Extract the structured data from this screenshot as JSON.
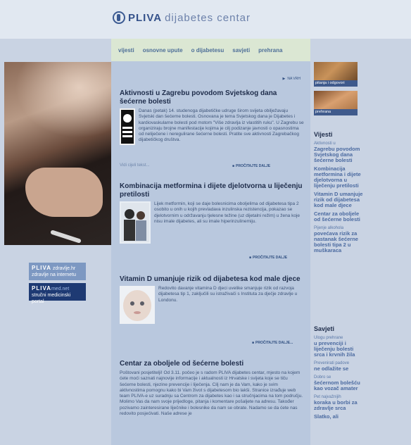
{
  "header": {
    "brand": "PLIVA",
    "subtitle": "dijabetes centar"
  },
  "nav": {
    "items": [
      "vijesti",
      "osnovne upute",
      "o dijabetesu",
      "savjeti",
      "prehrana"
    ]
  },
  "main": {
    "top_control": "NA VRH",
    "articles": [
      {
        "title": "Aktivnosti u Zagrebu povodom Svjetskog dana šećerne bolesti",
        "body": "Danas (petak) 14. studenoga dijabetičke udruge širom svijeta obilježavaju Svjetski dan šećerne bolesti. Osnovana je tema Svjetskog dana je Dijabetes i kardiovaskularne bolesti pod motom \"Više zdravlja iz vlastitih ruku\". U Zagrebu se organiziraju brojne manifestacije kojima je cilj podizanje javnosti o opasnostima od neliječene i neregulirane šećerne bolesti. Pratite sve aktivnosti Zagrebačkog dijabetičkog društva.",
        "lead": "Vidi cijeli tekst...",
        "more": "PROČITAJTE DALJE"
      },
      {
        "title": "Kombinacija metformina i dijete djelotvorna u liječenju pretilosti",
        "body": "Lijek metformin, koji se daje bolesnicima oboljelima od dijabetesa tipa 2 osobito u onih u kojih prevladava inzulinska rezistencija, pokazao se djelotvornim u održavanju tjelesne težine (uz dijetalni režim) u žena koje nisu imale dijabetes, ali su imale hiperinzulinemiju.",
        "more": "PROČITAJTE DALJE"
      },
      {
        "title": "Vitamin D umanjuje rizik od dijabetesa kod male djece",
        "body": "Redovito davanje vitamina D djeci uvelike smanjuje rizik od razvoja dijabetesa tip 1, zaključili su istraživači s Instituta za dječje zdravlje u Londonu.",
        "more": "PROČITAJTE DALJE..."
      },
      {
        "title": "Centar za oboljele od šećerne bolesti",
        "body": "Poštovani posjetitelji! Od 3.11. počeo je s radom PLIVA dijabetes centar, mjesto na kojem ćete moći saznati najnovije informacije i aktualnosti iz Hrvatske i svijeta koje se tiču šećerne bolesti, njezine prevencije i liječenja. Cilj nam je da Vam, kako je svim aktivnostima pomognu kako bi Vam život s dijabetesom bio lakši. Stranice izrađuje web team PLIVA-e uz suradnju sa Centrom za dijabetes kao i sa stručnjacima na tom području. Molimo Vas da nam svoje prijedloge, pitanja i komentare pošaljete na adresu. Također pozivamo zainteresirane liječnike i bolesnike da nam se obrate. Nadamo se da ćete nas redovito posjećivati. Naše adrese je"
      }
    ]
  },
  "sidebar": {
    "image1_caption": "pitanja i odgovori",
    "image2_caption": "prehrana",
    "news_heading": "Vijesti",
    "news": [
      {
        "a": "Aktivnosti u",
        "b": "Zagrebu povodom Svjetskog dana šećerne bolesti"
      },
      {
        "a": "",
        "b": "Kombinacija metformina i dijete djelotvorna u liječenju pretilosti"
      },
      {
        "a": "",
        "b": "Vitamin D umanjuje rizik od dijabetesa kod male djece"
      },
      {
        "a": "",
        "b": "Centar za oboljele od šećerne bolesti"
      },
      {
        "a": "Pijenje alkohola",
        "b": "povećava rizik za nastanak šećerne bolesti tipa 2 u muškaraca"
      }
    ],
    "tips_heading": "Savjeti",
    "tips": [
      {
        "a": "Ulogu prehrane",
        "b": "u prevenciji i liječenju bolesti srca i krvnih žila"
      },
      {
        "a": "Prevenirati padove",
        "b": "ne odlažite se"
      },
      {
        "a": "Dobro se",
        "b": "šećernom bolešću kao vozač amater"
      },
      {
        "a": "Pet najvažnijih",
        "b": "koraka u borbi za zdravlje srca"
      },
      {
        "a": "",
        "b": "Slatko, ali"
      }
    ]
  },
  "banners": {
    "b1_brand": "PLIVA",
    "b1_text": "zdravlje.hr",
    "b1_sub": "zdravlje na internetu",
    "b2_brand": "PLIVA",
    "b2_suffix": "med.net",
    "b2_sub": "stručni medicinski portal"
  }
}
